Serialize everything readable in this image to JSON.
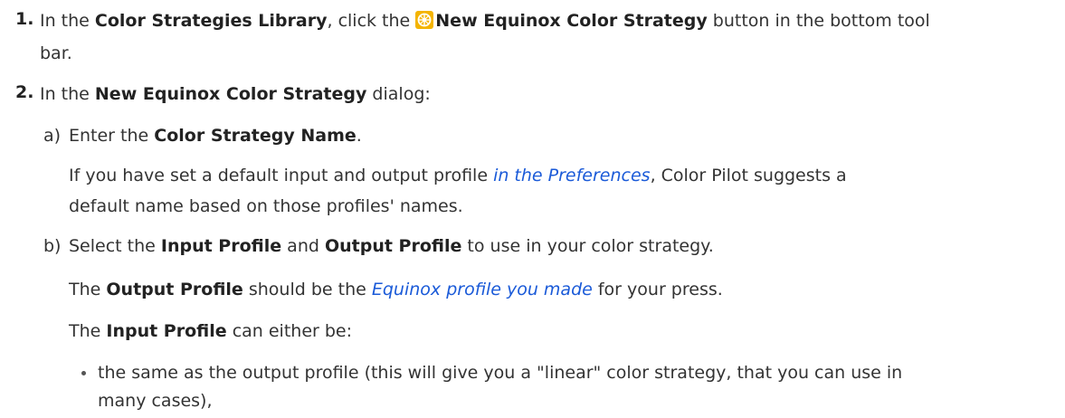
{
  "step1": {
    "number": "1.",
    "text_a": "In the ",
    "library": "Color Strategies Library",
    "text_b": ", click the ",
    "icon": "equinox-color-wheel-icon",
    "button": "New Equinox Color Strategy",
    "text_c": " button in the bottom tool",
    "line2": "bar."
  },
  "step2": {
    "number": "2.",
    "text_a": "In the ",
    "dialog": "New Equinox Color Strategy",
    "text_b": " dialog:"
  },
  "substep_a": {
    "label": "a)",
    "text_a": "Enter the ",
    "field": "Color Strategy Name",
    "text_b": ".",
    "info_a": "If you have set a default input and output profile ",
    "info_link": "in the Preferences",
    "info_b": ", Color Pilot suggests a",
    "info_line2": "default name based on those profiles' names."
  },
  "substep_b": {
    "label": "b)",
    "text_a": "Select the ",
    "input_profile": "Input Profile",
    "text_and": " and ",
    "output_profile": "Output Profile",
    "text_b": " to use in your color strategy.",
    "out_a": "The ",
    "out_profile": "Output Profile",
    "out_b": " should be the ",
    "out_link": "Equinox profile you made",
    "out_c": " for your press.",
    "in_a": "The ",
    "in_profile": "Input Profile",
    "in_b": " can either be:",
    "bullet_line1": "the same as the output profile (this will give you a \"linear\" color strategy, that you can use in",
    "bullet_line2": "many cases),"
  }
}
